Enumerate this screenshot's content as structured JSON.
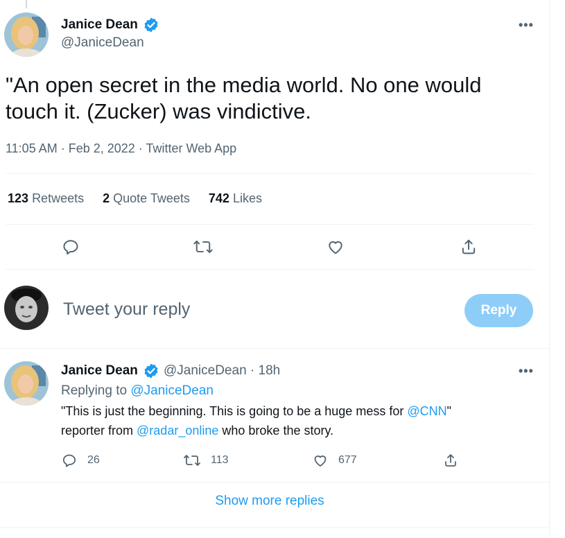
{
  "colors": {
    "accent": "#1d9bf0",
    "reply_button_bg": "#8ecdf8",
    "muted_text": "#536471",
    "divider": "#eff3f4"
  },
  "main_tweet": {
    "author_name": "Janice Dean",
    "author_handle": "@JaniceDean",
    "verified_icon": "verified-badge-icon",
    "more_label": "•••",
    "text": "\"An open secret in the media world.  No one would touch it.  (Zucker) was vindictive.",
    "timestamp": "11:05 AM · Feb 2, 2022 · Twitter Web App",
    "stats": {
      "retweets_count": "123",
      "retweets_label": "Retweets",
      "quotes_count": "2",
      "quotes_label": "Quote Tweets",
      "likes_count": "742",
      "likes_label": "Likes"
    },
    "actions": [
      "reply-icon",
      "retweet-icon",
      "like-icon",
      "share-icon"
    ]
  },
  "reply_composer": {
    "placeholder": "Tweet your reply",
    "button_label": "Reply"
  },
  "reply_tweet": {
    "author_name": "Janice Dean",
    "author_handle": "@JaniceDean",
    "separator": "·",
    "time_ago": "18h",
    "more_label": "•••",
    "replying_prefix": "Replying to",
    "replying_to": "@JaniceDean",
    "text_part1": "\"This is just the beginning.  This is going to be a huge mess for ",
    "mention_cnn": "@CNN",
    "text_part2": "\"",
    "text_part3": "reporter from ",
    "mention_radar": "@radar_online",
    "text_part4": " who broke the story.",
    "reply_count": "26",
    "retweet_count": "113",
    "like_count": "677"
  },
  "show_more_label": "Show more replies"
}
